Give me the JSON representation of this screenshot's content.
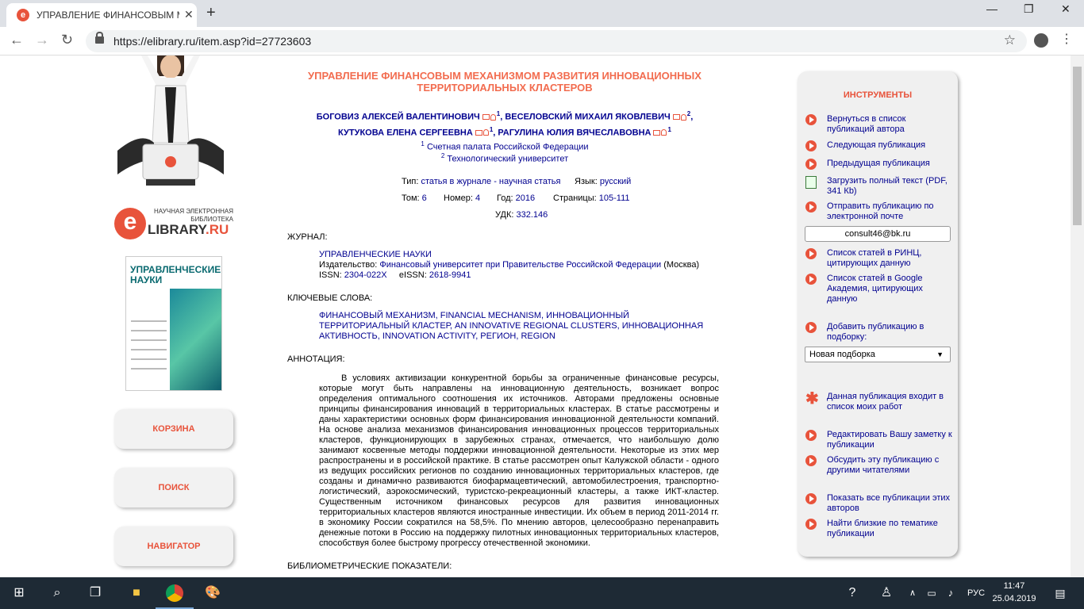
{
  "browser": {
    "tab_title": "УПРАВЛЕНИЕ ФИНАНСОВЫМ М",
    "url": "https://elibrary.ru/item.asp?id=27723603",
    "new_tab": "+",
    "tab_close": "✕"
  },
  "left": {
    "logo_subtitle": "НАУЧНАЯ ЭЛЕКТРОННАЯ БИБЛИОТЕКА",
    "logo_lib": "LIBRARY",
    "logo_ru": ".RU",
    "logo_e": "e",
    "cover_title": "УПРАВЛЕНЧЕСКИЕ НАУКИ",
    "buttons": [
      "КОРЗИНА",
      "ПОИСК",
      "НАВИГАТОР"
    ]
  },
  "article": {
    "title": "УПРАВЛЕНИЕ ФИНАНСОВЫМ МЕХАНИЗМОМ РАЗВИТИЯ ИННОВАЦИОННЫХ ТЕРРИТОРИАЛЬНЫХ КЛАСТЕРОВ",
    "authors": [
      {
        "name": "БОГОВИЗ АЛЕКСЕЙ ВАЛЕНТИНОВИЧ",
        "sup": "1"
      },
      {
        "name": "ВЕСЕЛОВСКИЙ МИХАИЛ ЯКОВЛЕВИЧ",
        "sup": "2"
      },
      {
        "name": "КУТУКОВА ЕЛЕНА СЕРГЕЕВНА",
        "sup": "1"
      },
      {
        "name": "РАГУЛИНА ЮЛИЯ ВЯЧЕСЛАВОВНА",
        "sup": "1"
      }
    ],
    "affiliations": [
      {
        "sup": "1",
        "name": "Счетная палата Российской Федерации"
      },
      {
        "sup": "2",
        "name": "Технологический университет"
      }
    ],
    "type_label": "Тип:",
    "type_value": "статья в журнале - научная статья",
    "lang_label": "Язык:",
    "lang_value": "русский",
    "vol_label": "Том:",
    "vol_value": "6",
    "num_label": "Номер:",
    "num_value": "4",
    "year_label": "Год:",
    "year_value": "2016",
    "pages_label": "Страницы:",
    "pages_value": "105-111",
    "udk_label": "УДК:",
    "udk_value": "332.146",
    "journal_heading": "ЖУРНАЛ:",
    "journal_name": "УПРАВЛЕНЧЕСКИЕ НАУКИ",
    "publisher_label": "Издательство:",
    "publisher": "Финансовый университет при Правительстве Российской Федерации",
    "publisher_city": "(Москва)",
    "issn_label": "ISSN:",
    "issn": "2304-022X",
    "eissn_label": "eISSN:",
    "eissn": "2618-9941",
    "keywords_heading": "КЛЮЧЕВЫЕ СЛОВА:",
    "keywords": "ФИНАНСОВЫЙ МЕХАНИЗМ, FINANCIAL MECHANISM, ИННОВАЦИОННЫЙ ТЕРРИТОРИАЛЬНЫЙ КЛАСТЕР, AN INNOVATIVE REGIONAL CLUSTERS, ИННОВАЦИОННАЯ АКТИВНОСТЬ, INNOVATION ACTIVITY, РЕГИОН, REGION",
    "abstract_heading": "АННОТАЦИЯ:",
    "abstract": "В условиях активизации конкурентной борьбы за ограниченные финансовые ресурсы, которые могут быть направлены на инновационную деятельность, возникает вопрос определения оптимального соотношения их источников. Авторами предложены основные принципы финансирования инноваций в территориальных кластерах. В статье рассмотрены и даны характеристики основных форм финансирования инновационной деятельности компаний. На основе анализа механизмов финансирования инновационных процессов территориальных кластеров, функционирующих в зарубежных странах, отмечается, что наибольшую долю занимают косвенные методы поддержки инновационной деятельности. Некоторые из этих мер распространены и в российской практике. В статье рассмотрен опыт Калужской области - одного из ведущих российских регионов по созданию инновационных территориальных кластеров, где созданы и динамично развиваются биофармацевтический, автомобилестроения, транспортно-логистический, аэрокосмический, туристско-рекреационный кластеры, а также ИКТ-кластер. Существенным источником финансовых ресурсов для развития инновационных территориальных кластеров являются иностранные инвестиции. Их объем в период 2011-2014 гг. в экономику России сократился на 58,5%. По мнению авторов, целесообразно перенаправить денежные потоки в Россию на поддержку пилотных инновационных территориальных кластеров, способствуя более быстрому прогрессу отечественной экономики.",
    "biblio_heading": "БИБЛИОМЕТРИЧЕСКИЕ ПОКАЗАТЕЛИ:"
  },
  "tools": {
    "heading": "ИНСТРУМЕНТЫ",
    "items": [
      "Вернуться в список публикаций автора",
      "Следующая публикация",
      "Предыдущая публикация",
      "Загрузить полный текст (PDF, 341 Кb)",
      "Отправить публикацию по электронной почте",
      "Список статей в РИНЦ, цитирующих данную",
      "Список статей в Google Академия, цитирующих данную",
      "Добавить публикацию в подборку:",
      "Данная публикация входит в список моих работ",
      "Редактировать Вашу заметку к публикации",
      "Обсудить эту публикацию с другими читателями",
      "Показать все публикации этих авторов",
      "Найти близкие по тематике публикации"
    ],
    "email": "consult46@bk.ru",
    "collection_selected": "Новая подборка"
  },
  "taskbar": {
    "lang": "РУС",
    "time": "11:47",
    "date": "25.04.2019"
  }
}
